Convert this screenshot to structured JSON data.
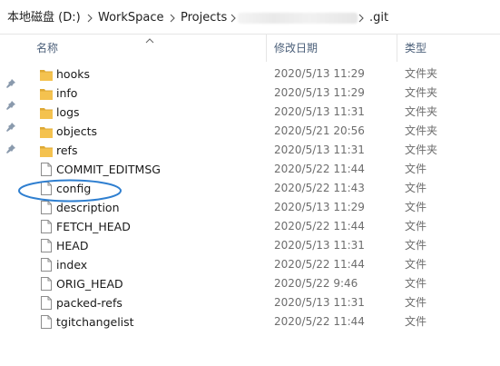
{
  "breadcrumb": {
    "drive": "本地磁盘 (D:)",
    "workspace": "WorkSpace",
    "projects": "Projects",
    "current": ".git"
  },
  "columns": {
    "name": "名称",
    "date": "修改日期",
    "type": "类型"
  },
  "files": [
    {
      "name": "hooks",
      "date": "2020/5/13 11:29",
      "type": "文件夹",
      "icon": "folder-icon"
    },
    {
      "name": "info",
      "date": "2020/5/13 11:29",
      "type": "文件夹",
      "icon": "folder-icon"
    },
    {
      "name": "logs",
      "date": "2020/5/13 11:31",
      "type": "文件夹",
      "icon": "folder-icon"
    },
    {
      "name": "objects",
      "date": "2020/5/21 20:56",
      "type": "文件夹",
      "icon": "folder-icon"
    },
    {
      "name": "refs",
      "date": "2020/5/13 11:31",
      "type": "文件夹",
      "icon": "folder-icon"
    },
    {
      "name": "COMMIT_EDITMSG",
      "date": "2020/5/22 11:44",
      "type": "文件",
      "icon": "file-icon"
    },
    {
      "name": "config",
      "date": "2020/5/22 11:43",
      "type": "文件",
      "icon": "file-icon"
    },
    {
      "name": "description",
      "date": "2020/5/13 11:29",
      "type": "文件",
      "icon": "file-icon"
    },
    {
      "name": "FETCH_HEAD",
      "date": "2020/5/22 11:44",
      "type": "文件",
      "icon": "file-icon"
    },
    {
      "name": "HEAD",
      "date": "2020/5/13 11:31",
      "type": "文件",
      "icon": "file-icon"
    },
    {
      "name": "index",
      "date": "2020/5/22 11:44",
      "type": "文件",
      "icon": "file-icon"
    },
    {
      "name": "ORIG_HEAD",
      "date": "2020/5/22 9:46",
      "type": "文件",
      "icon": "file-icon"
    },
    {
      "name": "packed-refs",
      "date": "2020/5/13 11:31",
      "type": "文件",
      "icon": "file-icon"
    },
    {
      "name": "tgitchangelist",
      "date": "2020/5/22 11:44",
      "type": "文件",
      "icon": "file-icon"
    }
  ],
  "colors": {
    "folder": "#f4c24f",
    "folder_dark": "#dea935",
    "header_text": "#4c607a",
    "annotation": "#2f7fd0"
  }
}
